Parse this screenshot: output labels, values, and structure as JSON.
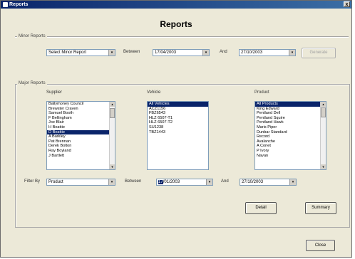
{
  "window": {
    "title": "Reports",
    "close_glyph": "x"
  },
  "heading": "Reports",
  "minor": {
    "group_label": "Minor Reports",
    "select": "Select Minor Report",
    "between_label": "Between",
    "from_date": "17/04/2003",
    "and_label": "And",
    "to_date": "27/10/2003",
    "generate_label": "Generate"
  },
  "major": {
    "group_label": "Major Reports",
    "supplier_label": "Supplier",
    "vehicle_label": "Vehicle",
    "product_label": "Product",
    "suppliers": [
      "Ballymoney Council",
      "Brewster Craven",
      "Samuel Booth",
      "F Bellingham",
      "Joe Blair",
      "H Beattie",
      "D Beattie",
      "A Barkley",
      "Pat Brennan",
      "Derek Bolton",
      "Ray Boyland",
      "J Bartlett"
    ],
    "supplier_selected_index": 6,
    "vehicles": [
      "All Vehicles",
      "ACZ1156",
      "FBZ6543",
      "HLZ 6507-T1",
      "HLZ 6507-T2",
      "SU1238",
      "TBZ1443"
    ],
    "vehicle_selected_index": 0,
    "products": [
      "All Products",
      "King Edward",
      "Pentland Dell",
      "Pentland Squire",
      "Pentland Hawk",
      "Maris Piper",
      "Dunbar Standard",
      "Record",
      "Avalanche",
      "A Conet",
      "P Ivory",
      "Navan"
    ],
    "product_selected_index": 0,
    "filter_label": "Filter By",
    "filter_value": "Product",
    "between_label": "Between",
    "from_date_highlight": "17",
    "from_date_rest": "/01/2003",
    "and_label": "And",
    "to_date": "27/10/2003",
    "detail_label": "Detail",
    "summary_label": "Summary"
  },
  "close_label": "Close",
  "arrow_glyph": "▾",
  "scroll_up": "▲",
  "scroll_down": "▼"
}
